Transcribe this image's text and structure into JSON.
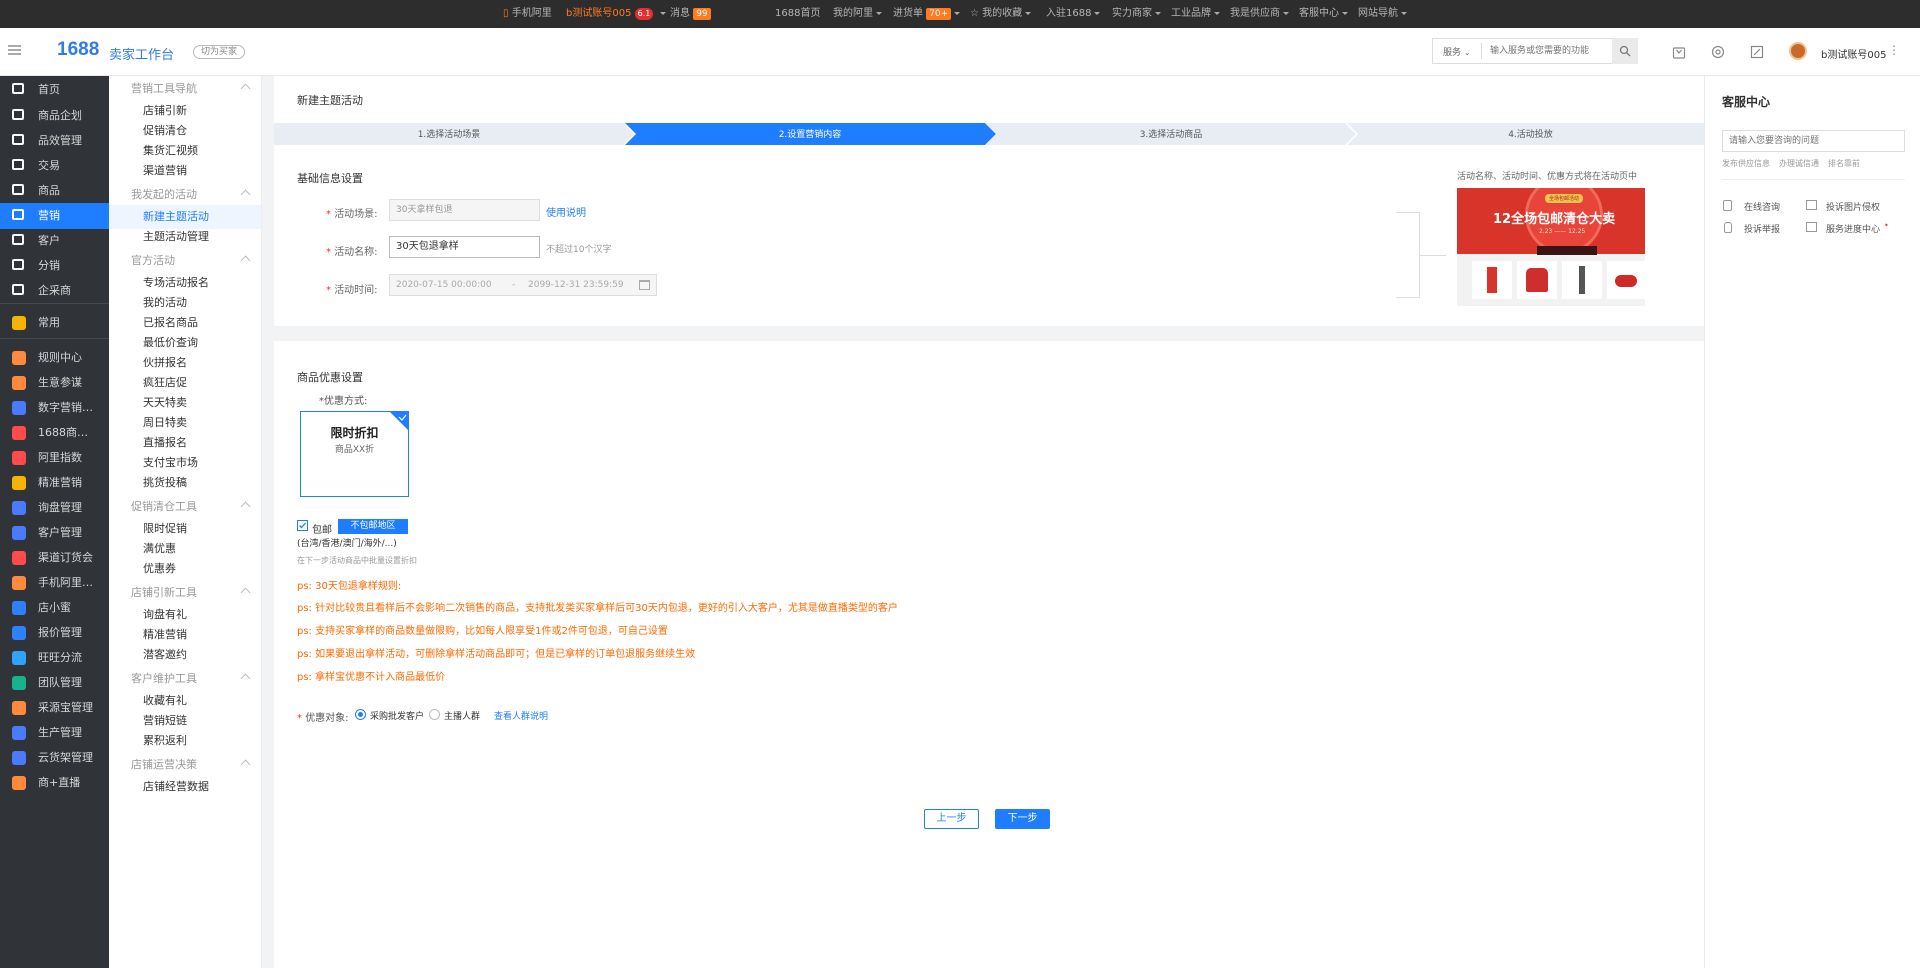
{
  "topbar": {
    "mobile": "手机阿里",
    "account": "b测试账号005",
    "account_badge": "6.1",
    "message": "消息",
    "message_count": "99",
    "home": "1688首页",
    "my_alibaba": "我的阿里",
    "purchase": "进货单",
    "purchase_count": "70+",
    "favorites": "我的收藏",
    "join": "入驻1688",
    "strong_merchants": "实力商家",
    "industrial": "工业品牌",
    "supplier": "我是供应商",
    "service": "客服中心",
    "sitemap": "网站导航"
  },
  "header": {
    "logo": "1688",
    "workbench": "卖家工作台",
    "switch_buyer": "切为买家",
    "search_scope": "服务",
    "search_placeholder": "输入服务或您需要的功能",
    "user": "b测试账号005"
  },
  "mainnav": [
    {
      "label": "首页",
      "color": "#ffffff"
    },
    {
      "label": "商品企划",
      "color": "#ffffff"
    },
    {
      "label": "品效管理",
      "color": "#ffffff"
    },
    {
      "label": "交易",
      "color": "#ffffff"
    },
    {
      "label": "商品",
      "color": "#ffffff"
    },
    {
      "label": "营销",
      "color": "#ffffff"
    },
    {
      "label": "客户",
      "color": "#ffffff"
    },
    {
      "label": "分销",
      "color": "#ffffff"
    },
    {
      "label": "企采商",
      "color": "#ffffff"
    },
    {
      "label": "常用",
      "color": "#f5b400"
    },
    {
      "label": "规则中心",
      "color": "#ff8a3d"
    },
    {
      "label": "生意参谋",
      "color": "#ff8a3d"
    },
    {
      "label": "数字营销…",
      "color": "#4a7bff"
    },
    {
      "label": "1688商…",
      "color": "#ff4b4b"
    },
    {
      "label": "阿里指数",
      "color": "#ff4b4b"
    },
    {
      "label": "精准营销",
      "color": "#f5b400"
    },
    {
      "label": "询盘管理",
      "color": "#4a7bff"
    },
    {
      "label": "客户管理",
      "color": "#4a7bff"
    },
    {
      "label": "渠道订货会",
      "color": "#ff4b4b"
    },
    {
      "label": "手机阿里…",
      "color": "#ff8a3d"
    },
    {
      "label": "店小蜜",
      "color": "#2f80ff"
    },
    {
      "label": "报价管理",
      "color": "#2f80ff"
    },
    {
      "label": "旺旺分流",
      "color": "#2fa3ff"
    },
    {
      "label": "团队管理",
      "color": "#19b28d"
    },
    {
      "label": "采源宝管理",
      "color": "#ff8a3d"
    },
    {
      "label": "生产管理",
      "color": "#4a7bff"
    },
    {
      "label": "云货架管理",
      "color": "#4a7bff"
    },
    {
      "label": "商+直播",
      "color": "#ff8a3d"
    }
  ],
  "subnav": {
    "g1": {
      "title": "营销工具导航",
      "items": [
        "店铺引新",
        "促销清仓",
        "集货汇视频",
        "渠道营销"
      ]
    },
    "g2": {
      "title": "我发起的活动",
      "items": [
        "新建主题活动",
        "主题活动管理"
      ]
    },
    "g3": {
      "title": "官方活动",
      "items": [
        "专场活动报名",
        "我的活动",
        "已报名商品",
        "最低价查询",
        "伙拼报名",
        "疯狂店促",
        "天天特卖",
        "周日特卖",
        "直播报名",
        "支付宝市场",
        "挑货投稿"
      ]
    },
    "g4": {
      "title": "促销清仓工具",
      "items": [
        "限时促销",
        "满优惠",
        "优惠券"
      ]
    },
    "g5": {
      "title": "店铺引新工具",
      "items": [
        "询盘有礼",
        "精准营销",
        "潜客邀约"
      ]
    },
    "g6": {
      "title": "客户维护工具",
      "items": [
        "收藏有礼",
        "营销短链",
        "累积返利"
      ]
    },
    "g7": {
      "title": "店铺运营决策",
      "items": [
        "店铺经营数据"
      ]
    }
  },
  "page": {
    "title": "新建主题活动",
    "steps": [
      "1.选择活动场景",
      "2.设置营销内容",
      "3.选择活动商品",
      "4.活动投放"
    ],
    "basic_title": "基础信息设置",
    "scene_label": "活动场景:",
    "scene_value": "30天拿样包退",
    "usage_link": "使用说明",
    "name_label": "活动名称:",
    "name_value": "30天包退拿样",
    "name_hint": "不超过10个汉字",
    "time_label": "活动时间:",
    "time_start": "2020-07-15 00:00:00",
    "time_sep": "-",
    "time_end": "2099-12-31 23:59:59",
    "preview_note": "活动名称、活动时间、优惠方式将在活动页中",
    "banner_tag": "全场包邮活动",
    "banner_title": "12全场包邮清仓大卖",
    "banner_dates": "2.23 —— 12.25",
    "discount_title": "商品优惠设置",
    "discount_label": "*优惠方式:",
    "card_title": "限时折扣",
    "card_sub": "商品XX折",
    "freeship": "包邮",
    "exclude_btn": "不包邮地区",
    "regions": "(台湾/香港/澳门/海外/...)",
    "next_step_hint": "在下一步活动商品中批量设置折扣",
    "ps": [
      "ps: 30天包退拿样规则:",
      "ps: 针对比较贵且看样后不会影响二次销售的商品，支持批发类买家拿样后可30天内包退，更好的引入大客户，尤其是做直播类型的客户",
      "ps: 支持买家拿样的商品数量做限购，比如每人限享受1件或2件可包退，可自己设置",
      "ps: 如果要退出拿样活动，可删除拿样活动商品即可；但是已拿样的订单包退服务继续生效",
      "ps: 拿样宝优惠不计入商品最低价"
    ],
    "target_label": "优惠对象:",
    "target_opt1": "采购批发客户",
    "target_opt2": "主播人群",
    "target_link": "查看人群说明",
    "prev_btn": "上一步",
    "next_btn": "下一步"
  },
  "service": {
    "title": "客服中心",
    "search_placeholder": "请输入您要咨询的问题",
    "tags": [
      "发布供应信息",
      "办理诚信通",
      "排名靠前"
    ],
    "links": [
      "在线咨询",
      "投诉图片侵权",
      "投诉举报",
      "服务进度中心"
    ]
  }
}
